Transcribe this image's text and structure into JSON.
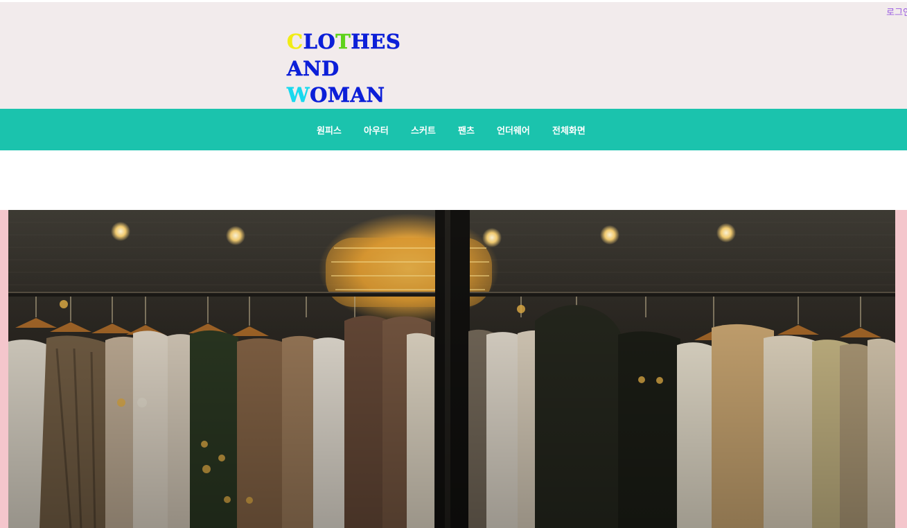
{
  "header": {
    "login_link": "로그인",
    "logo": {
      "line1": {
        "first": "C",
        "mid": "LO",
        "accent": "T",
        "rest": "HES"
      },
      "line2": "AND",
      "line3": {
        "first": "W",
        "rest": "OMAN"
      }
    }
  },
  "nav": {
    "items": [
      {
        "label": "원피스"
      },
      {
        "label": "아우터"
      },
      {
        "label": "스커트"
      },
      {
        "label": "팬츠"
      },
      {
        "label": "언더웨어"
      },
      {
        "label": "전체화면"
      }
    ]
  },
  "colors": {
    "header_bg": "#f2ebec",
    "logo_blue": "#0c1fd8",
    "logo_yellow": "#f1ec16",
    "logo_green": "#5ed21b",
    "logo_cyan": "#18d9ee",
    "nav_bg": "#1bc3ad",
    "banner_side": "#f4c6cc",
    "login_link": "#9a5be0"
  },
  "banner": {
    "image": "clothing-rack-photo"
  }
}
